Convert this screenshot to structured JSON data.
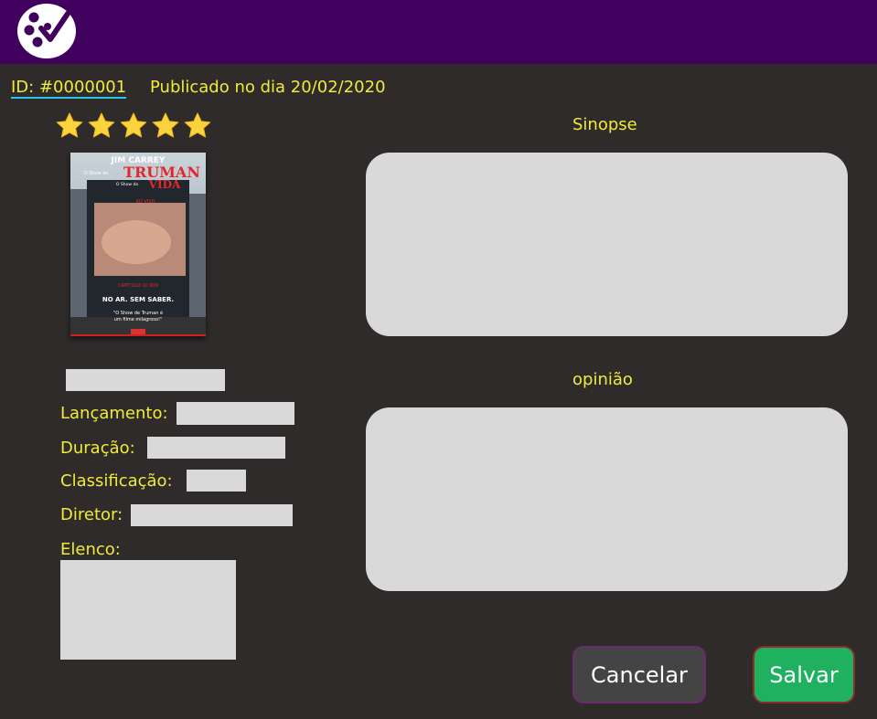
{
  "colors": {
    "topbar": "#40005e",
    "background": "#2f2b2b",
    "text": "#f2ea3a",
    "field": "#d9d9d9",
    "star": "#fbd33c",
    "save_button": "#1fb160",
    "cancel_button": "#444444"
  },
  "header": {
    "logo_icon": "film-reel-check-icon"
  },
  "meta": {
    "id_link": "ID: #0000001",
    "published": "Publicado no dia 20/02/2020"
  },
  "rating": {
    "stars": 5,
    "max": 5
  },
  "poster": {
    "actor": "JIM CARREY",
    "title_prefix": "O Show de",
    "title_main": "TRUMAN",
    "title_sub_prefix": "O Show da",
    "title_sub": "VIDA",
    "screen_tag": "AO VIVO",
    "chapter": "CAPÍTULO 10.909",
    "tagline": "NO AR. SEM SABER.",
    "quote_1": "\"O Show de Truman é",
    "quote_2": "um filme milagroso!\""
  },
  "details": {
    "title_value": "",
    "release_label": "Lançamento:",
    "release_value": "",
    "duration_label": "Duração:",
    "duration_value": "",
    "rating_label": "Classificação:",
    "rating_value": "",
    "director_label": "Diretor:",
    "director_value": "",
    "cast_label": "Elenco:",
    "cast_value": ""
  },
  "synopsis": {
    "label": "Sinopse",
    "value": ""
  },
  "opinion": {
    "label": "opinião",
    "value": ""
  },
  "actions": {
    "cancel": "Cancelar",
    "save": "Salvar"
  }
}
